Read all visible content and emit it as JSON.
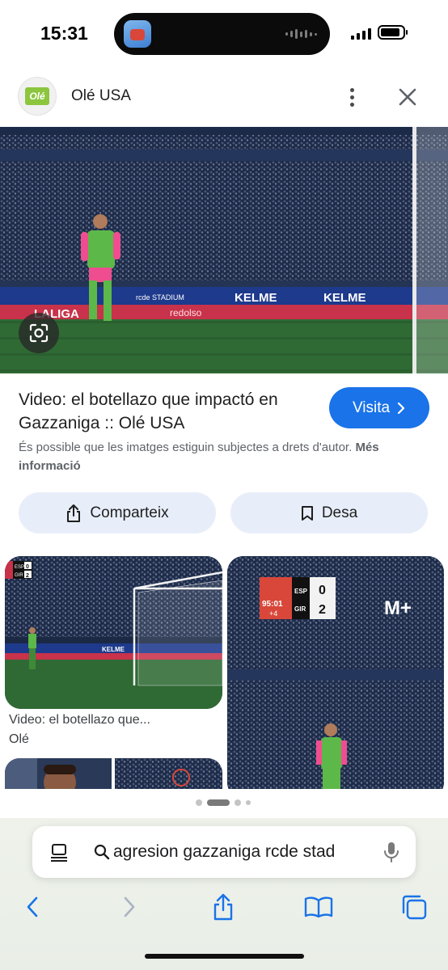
{
  "status_bar": {
    "time": "15:31"
  },
  "header": {
    "site_name": "Olé USA",
    "logo_text": "Olé"
  },
  "result": {
    "title": "Video: el botellazo que impactó en Gazzaniga :: Olé USA",
    "visit_label": "Visita",
    "copyright_text": "És possible que les imatges estiguin subjectes a drets d'autor.",
    "more_info_label": "Més informació"
  },
  "actions": {
    "share_label": "Comparteix",
    "save_label": "Desa"
  },
  "hero_image": {
    "banner_texts": [
      "KELME",
      "KELME",
      "rcde STADIUM",
      "redolso",
      "LALIGA"
    ]
  },
  "related": [
    {
      "caption": "Video: el botellazo que...",
      "source": "Olé",
      "scoreboard": {
        "home": "ESP",
        "away": "GIR",
        "home_score": "0",
        "away_score": "2"
      },
      "banner_text": "KELME"
    },
    {
      "scoreboard": {
        "clock": "95:01",
        "added": "+4",
        "home": "ESP",
        "away": "GIR",
        "home_score": "0",
        "away_score": "2"
      },
      "broadcaster": "M+"
    }
  ],
  "pagination": {
    "count": 4,
    "active": 1
  },
  "safari": {
    "search_query": "agresion gazzaniga rcde stad"
  },
  "colors": {
    "accent": "#1a73e8",
    "pill_bg": "#e8eef9",
    "pitch": "#2f6a34",
    "kit_green": "#5cb848",
    "kit_pink": "#ee4e8f"
  }
}
